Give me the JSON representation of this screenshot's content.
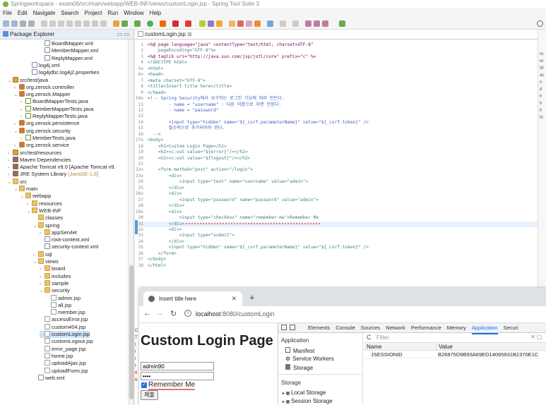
{
  "window": {
    "title": "Springworkspace - exam06/src/main/webapp/WEB-INF/views/customLogin.jsp - Spring Tool Suite 3"
  },
  "menu": [
    "File",
    "Edit",
    "Navigate",
    "Search",
    "Project",
    "Run",
    "Window",
    "Help"
  ],
  "package_explorer": {
    "tab_label": "Package Explorer",
    "rows": [
      {
        "t": "BoardMapper.xml",
        "i": "xml",
        "d": 6
      },
      {
        "t": "MemberMapper.xml",
        "i": "xml",
        "d": 6
      },
      {
        "t": "ReplyMapper.xml",
        "i": "xml",
        "d": 6
      },
      {
        "t": "log4j.xml",
        "i": "xml",
        "d": 4
      },
      {
        "t": "log4jdbc.log4j2.properties",
        "i": "xml",
        "d": 4
      },
      {
        "t": "src/test/java",
        "i": "src",
        "d": 1,
        "tw": "v"
      },
      {
        "t": "org.zerock.controller",
        "i": "pkg",
        "d": 2,
        "tw": ">"
      },
      {
        "t": "org.zerock.Mapper",
        "i": "pkg",
        "d": 2,
        "tw": "v"
      },
      {
        "t": "BoardMapperTests.java",
        "i": "java",
        "d": 3,
        "tw": ">"
      },
      {
        "t": "MemberMapperTests.java",
        "i": "java",
        "d": 3,
        "tw": ">"
      },
      {
        "t": "ReplyMapperTests.java",
        "i": "java",
        "d": 3,
        "tw": ">"
      },
      {
        "t": "org.zerock.persistence",
        "i": "pkg",
        "d": 2,
        "tw": ">"
      },
      {
        "t": "org.zerock.security",
        "i": "pkg",
        "d": 2,
        "tw": "v"
      },
      {
        "t": "MemberTests.java",
        "i": "java",
        "d": 3,
        "tw": ">"
      },
      {
        "t": "org.zerock.service",
        "i": "pkg",
        "d": 2,
        "tw": ">"
      },
      {
        "t": "src/test/resources",
        "i": "src",
        "d": 1,
        "tw": ">"
      },
      {
        "t": "Maven Dependencies",
        "i": "lib",
        "d": 1,
        "tw": ">"
      },
      {
        "t": "Apache Tomcat v9.0 [Apache Tomcat v9.",
        "i": "lib",
        "d": 1,
        "tw": ">"
      },
      {
        "t": "JRE System Library",
        "i": "lib",
        "d": 1,
        "tw": ">",
        "extra": "[JavaSE-1.8]"
      },
      {
        "t": "src",
        "i": "folder",
        "d": 1,
        "tw": "v"
      },
      {
        "t": "main",
        "i": "folder",
        "d": 2,
        "tw": "v"
      },
      {
        "t": "webapp",
        "i": "folder",
        "d": 3,
        "tw": "v"
      },
      {
        "t": "resources",
        "i": "folder",
        "d": 4,
        "tw": ">"
      },
      {
        "t": "WEB-INF",
        "i": "folder",
        "d": 4,
        "tw": "v"
      },
      {
        "t": "classes",
        "i": "folder",
        "d": 5
      },
      {
        "t": "spring",
        "i": "folder",
        "d": 5,
        "tw": "v"
      },
      {
        "t": "appServlet",
        "i": "folder",
        "d": 6,
        "tw": ">"
      },
      {
        "t": "root-context.xml",
        "i": "xml",
        "d": 6
      },
      {
        "t": "security-context.xml",
        "i": "xml",
        "d": 6
      },
      {
        "t": "sql",
        "i": "folder",
        "d": 5,
        "tw": ">"
      },
      {
        "t": "views",
        "i": "folder",
        "d": 5,
        "tw": "v"
      },
      {
        "t": "board",
        "i": "folder",
        "d": 6,
        "tw": ">"
      },
      {
        "t": "includes",
        "i": "folder",
        "d": 6,
        "tw": ">"
      },
      {
        "t": "sample",
        "i": "folder",
        "d": 6,
        "tw": ">"
      },
      {
        "t": "security",
        "i": "folder",
        "d": 6,
        "tw": "v"
      },
      {
        "t": "admin.jsp",
        "i": "jsp",
        "d": 7
      },
      {
        "t": "all.jsp",
        "i": "jsp",
        "d": 7
      },
      {
        "t": "member.jsp",
        "i": "jsp",
        "d": 7
      },
      {
        "t": "accessError.jsp",
        "i": "jsp",
        "d": 6
      },
      {
        "t": "custom404.jsp",
        "i": "jsp",
        "d": 6
      },
      {
        "t": "customLogin.jsp",
        "i": "jsp",
        "d": 6,
        "sel": true
      },
      {
        "t": "customLogout.jsp",
        "i": "jsp",
        "d": 6
      },
      {
        "t": "error_page.jsp",
        "i": "jsp",
        "d": 6
      },
      {
        "t": "home.jsp",
        "i": "jsp",
        "d": 6
      },
      {
        "t": "uploadAjax.jsp",
        "i": "jsp",
        "d": 6
      },
      {
        "t": "uploadForm.jsp",
        "i": "jsp",
        "d": 6
      },
      {
        "t": "web.xml",
        "i": "xml",
        "d": 5
      }
    ]
  },
  "editor": {
    "tab_label": "customLogin.jsp",
    "lines": [
      {
        "n": "1",
        "h": "<%@ page language=\"java\" contentType=\"text/html; charset=UTF-8\""
      },
      {
        "n": "2",
        "h": "    pageEncoding=\"UTF-8\"%>"
      },
      {
        "n": "3",
        "h": "<%@ taglib uri=\"http://java.sun.com/jsp/jstl/core\" prefix=\"c\" %>"
      },
      {
        "n": "4",
        "h": "<!DOCTYPE html>"
      },
      {
        "n": "5⊖",
        "h": "<html>"
      },
      {
        "n": "6⊖",
        "h": "<head>"
      },
      {
        "n": "7",
        "h": "<meta charset=\"UTF-8\">"
      },
      {
        "n": "8",
        "h": "<title>Insert title here</title>"
      },
      {
        "n": "9",
        "h": "</head>"
      },
      {
        "n": "10⊖",
        "h": "<!-- Spring Security에서 요구하는 로그인 기능에 따라 만든다."
      },
      {
        "n": "11",
        "h": "        - name = \"username\" : 다른 이름으로 하면 안된다."
      },
      {
        "n": "12",
        "h": "        - name = \"password\""
      },
      {
        "n": "13",
        "h": ""
      },
      {
        "n": "14",
        "h": "        <input type=\"hidden\" name=\"${_csrf.parameterName}\" value=\"${_csrf.token}\" />"
      },
      {
        "n": "15",
        "h": "        필수적으로 추가되어야 한다."
      },
      {
        "n": "16",
        "h": "  -->"
      },
      {
        "n": "17⊖",
        "h": "<body>"
      },
      {
        "n": "18",
        "h": "    <h1>Custom Login Page</h1>"
      },
      {
        "n": "19",
        "h": "    <h2><c:out value=\"${error}\"/></h2>"
      },
      {
        "n": "20",
        "h": "    <h2><c:out value=\"${logout}\"/></h2>"
      },
      {
        "n": "21",
        "h": ""
      },
      {
        "n": "22⊖",
        "h": "    <form method=\"post\" action=\"/login\">"
      },
      {
        "n": "23⊖",
        "h": "        <div>"
      },
      {
        "n": "24",
        "h": "            <input type=\"text\" name=\"username\" value=\"admin\">"
      },
      {
        "n": "25",
        "h": "        </div>"
      },
      {
        "n": "26⊖",
        "h": "        <div>"
      },
      {
        "n": "27",
        "h": "            <input type=\"password\" name=\"password\" value=\"admin\">"
      },
      {
        "n": "28",
        "h": "        </div>"
      },
      {
        "n": "29⊖",
        "h": "        <div>"
      },
      {
        "n": "30",
        "h": "            <input type=\"checkbox\" name=\"remember-me\">Remember Me"
      },
      {
        "n": "31",
        "h": "        </div>",
        "cur": true
      },
      {
        "n": "32⊖",
        "h": "        <div>"
      },
      {
        "n": "33",
        "h": "            <input type=\"submit\">"
      },
      {
        "n": "34",
        "h": "        </div>"
      },
      {
        "n": "35",
        "h": "        <input type=\"hidden\" name=\"${_csrf.parameterName}\" value=\"${_csrf.token}\" />"
      },
      {
        "n": "36",
        "h": "    </form>"
      },
      {
        "n": "37",
        "h": "</body>"
      },
      {
        "n": "38",
        "h": "</html>"
      }
    ]
  },
  "browser": {
    "tab_title": "Insert title here",
    "new_tab": "+",
    "url_host": "localhost",
    "url_rest": ":8080/customLogin",
    "page": {
      "heading": "Custom Login Page",
      "username_value": "admin90",
      "password_mask": "••••",
      "remember_label": "Remember Me",
      "submit_label": "제출"
    },
    "devtools": {
      "tabs": [
        "Elements",
        "Console",
        "Sources",
        "Network",
        "Performance",
        "Memory",
        "Application",
        "Securi"
      ],
      "active_tab": "Application",
      "sidebar_heading": "Application",
      "sidebar_items": [
        "Manifest",
        "Service Workers",
        "Storage"
      ],
      "storage_heading": "Storage",
      "storage_items": [
        "Local Storage",
        "Session Storage"
      ],
      "filter_placeholder": "Filter",
      "columns": [
        "Name",
        "Value"
      ],
      "cookie_name": "JSESSIONID",
      "cookie_value": "B26875D9B93A69ED14065931B2370E1C"
    }
  },
  "right_panel_letters": [
    "re",
    "re",
    "W",
    "ac",
    "n",
    "d",
    "h",
    "h",
    "h",
    "fo"
  ],
  "console_letters": [
    "C",
    "T",
    "I",
    "I",
    "I",
    "I",
    "6",
    "6"
  ]
}
